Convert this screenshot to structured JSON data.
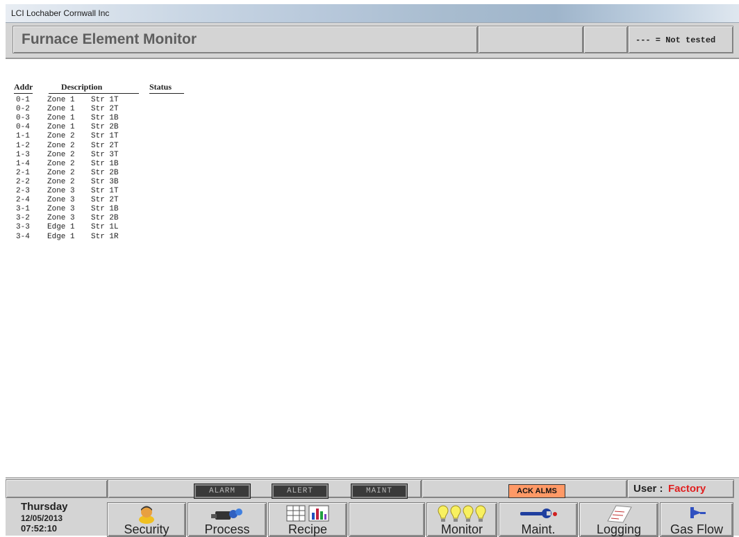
{
  "window": {
    "title": "LCI  Lochaber Cornwall Inc"
  },
  "header": {
    "title": "Furnace Element Monitor",
    "legend": "--- = Not tested"
  },
  "columns": {
    "addr": "Addr",
    "description": "Description",
    "status": "Status"
  },
  "rows": [
    {
      "addr": "0-1",
      "zone": "Zone 1",
      "str": "Str 1T"
    },
    {
      "addr": "0-2",
      "zone": "Zone 1",
      "str": "Str 2T"
    },
    {
      "addr": "0-3",
      "zone": "Zone 1",
      "str": "Str 1B"
    },
    {
      "addr": "0-4",
      "zone": "Zone 1",
      "str": "Str 2B"
    },
    {
      "addr": "1-1",
      "zone": "Zone 2",
      "str": "Str 1T"
    },
    {
      "addr": "1-2",
      "zone": "Zone 2",
      "str": "Str 2T"
    },
    {
      "addr": "1-3",
      "zone": "Zone 2",
      "str": "Str 3T"
    },
    {
      "addr": "1-4",
      "zone": "Zone 2",
      "str": "Str 1B"
    },
    {
      "addr": "2-1",
      "zone": "Zone 2",
      "str": "Str 2B"
    },
    {
      "addr": "2-2",
      "zone": "Zone 2",
      "str": "Str 3B"
    },
    {
      "addr": "2-3",
      "zone": "Zone 3",
      "str": "Str 1T"
    },
    {
      "addr": "2-4",
      "zone": "Zone 3",
      "str": "Str 2T"
    },
    {
      "addr": "3-1",
      "zone": "Zone 3",
      "str": "Str 1B"
    },
    {
      "addr": "3-2",
      "zone": "Zone 3",
      "str": "Str 2B"
    },
    {
      "addr": "3-3",
      "zone": "Edge 1",
      "str": "Str 1L"
    },
    {
      "addr": "3-4",
      "zone": "Edge 1",
      "str": "Str 1R"
    }
  ],
  "status_bar": {
    "alarm": "ALARM",
    "alert": "ALERT",
    "maint": "MAINT",
    "ack": "ACK ALMS",
    "user_label": "User :",
    "user_value": "Factory",
    "user_color": "#e02020",
    "ack_color": "#ff9966"
  },
  "datetime": {
    "day": "Thursday",
    "date": "12/05/2013",
    "time": "07:52:10"
  },
  "nav": {
    "security": "Security",
    "process": "Process",
    "recipe": "Recipe",
    "monitor": "Monitor",
    "maint": "Maint.",
    "logging": "Logging",
    "gasflow": "Gas Flow"
  },
  "icons": {
    "security": "person-icon",
    "process": "binoculars-icon",
    "recipe": "table-chart-icon",
    "monitor": "lightbulbs-icon",
    "maint": "wrench-icon",
    "logging": "notepad-icon",
    "gasflow": "valve-icon"
  }
}
